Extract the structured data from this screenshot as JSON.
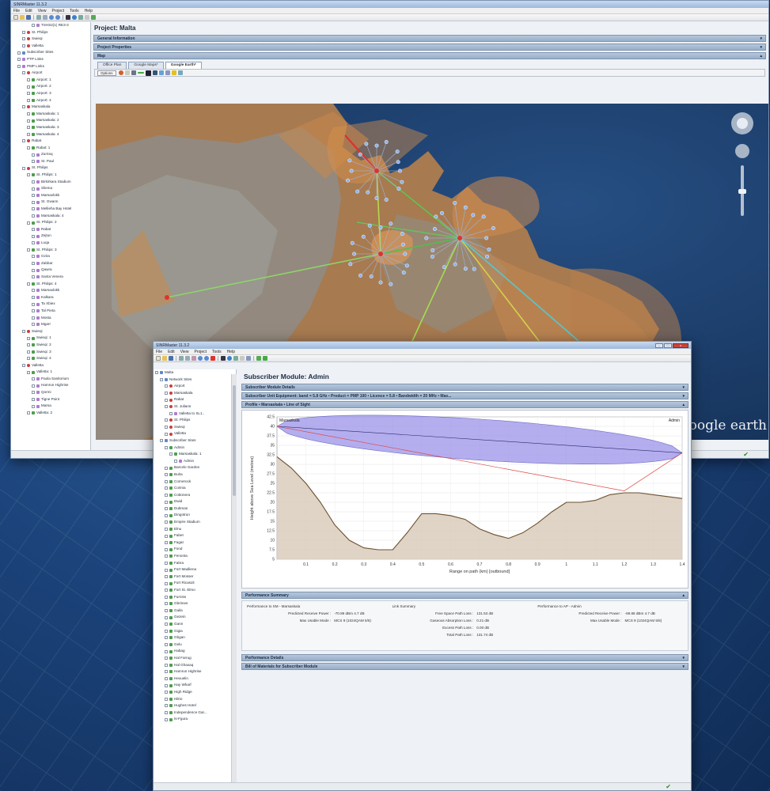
{
  "back_window": {
    "title": "SINRMaster 11.3.2",
    "menu": [
      "File",
      "Edit",
      "View",
      "Project",
      "Tools",
      "Help"
    ],
    "project_title": "Project: Malta",
    "sections": [
      {
        "label": "General Information"
      },
      {
        "label": "Project Properties"
      },
      {
        "label": "Map"
      }
    ],
    "tabs": [
      {
        "label": "Office Plan"
      },
      {
        "label": "Google Maps*"
      },
      {
        "label": "Google Earth*"
      }
    ],
    "map_tool_label": "Options",
    "google_earth_brand": "Google earth",
    "tree": [
      {
        "label": "TSHS2(1) RE3-3",
        "depth": 4,
        "type": "link"
      },
      {
        "label": "St. Philips",
        "depth": 2,
        "type": "site"
      },
      {
        "label": "Swieqi",
        "depth": 2,
        "type": "site"
      },
      {
        "label": "Valletta",
        "depth": 2,
        "type": "site"
      },
      {
        "label": "Subscriber Sites",
        "depth": 1,
        "type": "net"
      },
      {
        "label": "PTP Links",
        "depth": 1,
        "type": "link"
      },
      {
        "label": "PMP Links",
        "depth": 1,
        "type": "link"
      },
      {
        "label": "Airport",
        "depth": 2,
        "type": "site"
      },
      {
        "label": "Airport: 1",
        "depth": 3,
        "type": "sub"
      },
      {
        "label": "Airport: 2",
        "depth": 3,
        "type": "sub"
      },
      {
        "label": "Airport: 3",
        "depth": 3,
        "type": "sub"
      },
      {
        "label": "Airport: 4",
        "depth": 3,
        "type": "sub"
      },
      {
        "label": "Marsaskala",
        "depth": 2,
        "type": "site"
      },
      {
        "label": "Marsaskala: 1",
        "depth": 3,
        "type": "sub"
      },
      {
        "label": "Marsaskala: 2",
        "depth": 3,
        "type": "sub"
      },
      {
        "label": "Marsaskala: 3",
        "depth": 3,
        "type": "sub"
      },
      {
        "label": "Marsaskala: 4",
        "depth": 3,
        "type": "sub"
      },
      {
        "label": "Rabat",
        "depth": 2,
        "type": "site"
      },
      {
        "label": "Rabat: 1",
        "depth": 3,
        "type": "sub"
      },
      {
        "label": "Zurrieq",
        "depth": 4,
        "type": "link"
      },
      {
        "label": "St. Paul",
        "depth": 4,
        "type": "link"
      },
      {
        "label": "St. Philips",
        "depth": 2,
        "type": "site"
      },
      {
        "label": "St. Philips: 1",
        "depth": 3,
        "type": "sub"
      },
      {
        "label": "Birkirkara Stadium",
        "depth": 4,
        "type": "link"
      },
      {
        "label": "Sliema",
        "depth": 4,
        "type": "link"
      },
      {
        "label": "Marsaxlokk",
        "depth": 4,
        "type": "link"
      },
      {
        "label": "St. Gwann",
        "depth": 4,
        "type": "link"
      },
      {
        "label": "Mellieha Bay Hotel",
        "depth": 4,
        "type": "link"
      },
      {
        "label": "Marsaskala: 4",
        "depth": 4,
        "type": "link"
      },
      {
        "label": "St. Philips: 2",
        "depth": 3,
        "type": "sub"
      },
      {
        "label": "Rabat",
        "depth": 4,
        "type": "link"
      },
      {
        "label": "Zejtun",
        "depth": 4,
        "type": "link"
      },
      {
        "label": "Luqa",
        "depth": 4,
        "type": "link"
      },
      {
        "label": "St. Philips: 3",
        "depth": 3,
        "type": "sub"
      },
      {
        "label": "Gzira",
        "depth": 4,
        "type": "link"
      },
      {
        "label": "Zabbar",
        "depth": 4,
        "type": "link"
      },
      {
        "label": "Qawra",
        "depth": 4,
        "type": "link"
      },
      {
        "label": "Santa Venera",
        "depth": 4,
        "type": "link"
      },
      {
        "label": "St. Philips: 4",
        "depth": 3,
        "type": "sub"
      },
      {
        "label": "Marsaxlokk",
        "depth": 4,
        "type": "link"
      },
      {
        "label": "Kalkara",
        "depth": 4,
        "type": "link"
      },
      {
        "label": "Ta Xbiex",
        "depth": 4,
        "type": "link"
      },
      {
        "label": "Tal Pieta",
        "depth": 4,
        "type": "link"
      },
      {
        "label": "Mosta",
        "depth": 4,
        "type": "link"
      },
      {
        "label": "Mgarr",
        "depth": 4,
        "type": "link"
      },
      {
        "label": "Swieqi",
        "depth": 2,
        "type": "site"
      },
      {
        "label": "Swieqi: 1",
        "depth": 3,
        "type": "sub"
      },
      {
        "label": "Swieqi: 2",
        "depth": 3,
        "type": "sub"
      },
      {
        "label": "Swieqi: 3",
        "depth": 3,
        "type": "sub"
      },
      {
        "label": "Swieqi: 4",
        "depth": 3,
        "type": "sub"
      },
      {
        "label": "Valletta",
        "depth": 2,
        "type": "site"
      },
      {
        "label": "Valletta: 1",
        "depth": 3,
        "type": "sub"
      },
      {
        "label": "Paola Sanitorium",
        "depth": 4,
        "type": "link"
      },
      {
        "label": "Hamrun Highrise",
        "depth": 4,
        "type": "link"
      },
      {
        "label": "Qormi",
        "depth": 4,
        "type": "link"
      },
      {
        "label": "Tigne Point",
        "depth": 4,
        "type": "link"
      },
      {
        "label": "Marsa",
        "depth": 4,
        "type": "link"
      },
      {
        "label": "Valletta: 2",
        "depth": 3,
        "type": "sub"
      }
    ]
  },
  "front_window": {
    "title": "SINRMaster 11.3.2",
    "menu": [
      "File",
      "Edit",
      "View",
      "Project",
      "Tools",
      "Help"
    ],
    "page_title": "Subscriber Module: Admin",
    "sections": [
      {
        "label": "Subscriber Module Details"
      },
      {
        "label": "Subscriber Unit Equipment: band = 5.8 GHz • Product = PMP 100 • Licence = 5.8 • Bandwidth = 20 MHz • Max..."
      },
      {
        "label": "Profile • Marsaskala • Line of Sight"
      }
    ],
    "lower_sections": [
      {
        "label": "Performance Summary"
      },
      {
        "label": "Performance Details"
      },
      {
        "label": "Bill of Materials for Subscriber Module"
      }
    ],
    "tree": [
      {
        "label": "Malta",
        "depth": 0,
        "type": "net"
      },
      {
        "label": "Network Sites",
        "depth": 1,
        "type": "net"
      },
      {
        "label": "Airport",
        "depth": 2,
        "type": "site"
      },
      {
        "label": "Marsaskala",
        "depth": 2,
        "type": "site"
      },
      {
        "label": "Rabat",
        "depth": 2,
        "type": "site"
      },
      {
        "label": "St. Julians",
        "depth": 2,
        "type": "site"
      },
      {
        "label": "Valletta to SL1..",
        "depth": 3,
        "type": "link"
      },
      {
        "label": "St. Philips",
        "depth": 2,
        "type": "site"
      },
      {
        "label": "Swieqi",
        "depth": 2,
        "type": "site"
      },
      {
        "label": "Valletta",
        "depth": 2,
        "type": "site"
      },
      {
        "label": "Subscriber Sites",
        "depth": 1,
        "type": "net"
      },
      {
        "label": "Admin",
        "depth": 2,
        "type": "sub"
      },
      {
        "label": "Marsaskala: 1",
        "depth": 3,
        "type": "sub"
      },
      {
        "label": "Admin",
        "depth": 4,
        "type": "link"
      },
      {
        "label": "Barcelo Garden",
        "depth": 2,
        "type": "sub"
      },
      {
        "label": "Bulra",
        "depth": 2,
        "type": "sub"
      },
      {
        "label": "Cornerock",
        "depth": 2,
        "type": "sub"
      },
      {
        "label": "Corinia",
        "depth": 2,
        "type": "sub"
      },
      {
        "label": "Cottonera",
        "depth": 2,
        "type": "sub"
      },
      {
        "label": "Dwid",
        "depth": 2,
        "type": "sub"
      },
      {
        "label": "Dubman",
        "depth": 2,
        "type": "sub"
      },
      {
        "label": "Dingotrun",
        "depth": 2,
        "type": "sub"
      },
      {
        "label": "Empire Stadium",
        "depth": 2,
        "type": "sub"
      },
      {
        "label": "Elnu",
        "depth": 2,
        "type": "sub"
      },
      {
        "label": "Fabet",
        "depth": 2,
        "type": "sub"
      },
      {
        "label": "Fagat",
        "depth": 2,
        "type": "sub"
      },
      {
        "label": "Fond",
        "depth": 2,
        "type": "sub"
      },
      {
        "label": "Fenonta",
        "depth": 2,
        "type": "sub"
      },
      {
        "label": "Fabra",
        "depth": 2,
        "type": "sub"
      },
      {
        "label": "Fort Madliena",
        "depth": 2,
        "type": "sub"
      },
      {
        "label": "Fort Mosser",
        "depth": 2,
        "type": "sub"
      },
      {
        "label": "Fort Ricasoli",
        "depth": 2,
        "type": "sub"
      },
      {
        "label": "Fort St. Elmo",
        "depth": 2,
        "type": "sub"
      },
      {
        "label": "Furniss",
        "depth": 2,
        "type": "sub"
      },
      {
        "label": "Gbrimes",
        "depth": 2,
        "type": "sub"
      },
      {
        "label": "Gaila",
        "depth": 2,
        "type": "sub"
      },
      {
        "label": "Gezein",
        "depth": 2,
        "type": "sub"
      },
      {
        "label": "Gann",
        "depth": 2,
        "type": "sub"
      },
      {
        "label": "Gigia",
        "depth": 2,
        "type": "sub"
      },
      {
        "label": "Gbgan",
        "depth": 2,
        "type": "sub"
      },
      {
        "label": "Gelu",
        "depth": 2,
        "type": "sub"
      },
      {
        "label": "Habag",
        "depth": 2,
        "type": "sub"
      },
      {
        "label": "Hal Farrug",
        "depth": 2,
        "type": "sub"
      },
      {
        "label": "Hal Ghaxaq",
        "depth": 2,
        "type": "sub"
      },
      {
        "label": "Hamrun Highrise",
        "depth": 2,
        "type": "sub"
      },
      {
        "label": "Hexuelin",
        "depth": 2,
        "type": "sub"
      },
      {
        "label": "Hay Wharf",
        "depth": 2,
        "type": "sub"
      },
      {
        "label": "High Ridge",
        "depth": 2,
        "type": "sub"
      },
      {
        "label": "Hilrio",
        "depth": 2,
        "type": "sub"
      },
      {
        "label": "Hughes Hotel",
        "depth": 2,
        "type": "sub"
      },
      {
        "label": "Independence Gar...",
        "depth": 2,
        "type": "sub"
      },
      {
        "label": "Is-Fgura",
        "depth": 2,
        "type": "sub"
      }
    ],
    "perf": {
      "left_title": "Performance to SM - Marsaskala",
      "left_rows": [
        {
          "k": "Predicted Receive Power :",
          "v": "-70.89 dBm  4.7 dB"
        },
        {
          "k": "Max Usable Mode :",
          "v": "MCS 9 (1024QAM 5/6)"
        }
      ],
      "mid_title": "Link Summary",
      "mid_rows": [
        {
          "k": "Free Space Path Loss :",
          "v": "131.53 dB"
        },
        {
          "k": "Gaseous Absorption Loss :",
          "v": "0.21 dB"
        },
        {
          "k": "Excess Path Loss :",
          "v": "0.00 dB"
        },
        {
          "k": "Total Path Loss :",
          "v": "131.74 dB"
        }
      ],
      "right_title": "Performance to AP - Admin",
      "right_rows": [
        {
          "k": "Predicted Receive Power :",
          "v": "-69.88 dBm  4.7 dB"
        },
        {
          "k": "Max Usable Mode :",
          "v": "MCS 9 (1024QAM 5/6)"
        }
      ]
    }
  },
  "colors": {
    "terrain_fill": "#d9cdbb",
    "terrain_line": "#6d5230",
    "fresnel_fill": "#9b93ea",
    "los_line": "#e04848",
    "map_sea": "#1c3e6d",
    "map_land": "#b07a45"
  },
  "chart_data": {
    "type": "area",
    "title": "",
    "xlabel": "Range on path (km) [outbound]",
    "ylabel": "Height above Sea Level (metres)",
    "xlim": [
      0,
      1.4
    ],
    "ylim": [
      5,
      42.5
    ],
    "x_ticks": [
      0.1,
      0.2,
      0.3,
      0.4,
      0.5,
      0.6,
      0.7,
      0.8,
      0.9,
      1,
      1.1,
      1.2,
      1.3,
      1.4
    ],
    "y_ticks": [
      5,
      7.5,
      10,
      12.5,
      15,
      17.5,
      20,
      22.5,
      25,
      27.5,
      30,
      32.5,
      35,
      37.5,
      40,
      42.5
    ],
    "left_end_label": "Marsaskala",
    "right_end_label": "Admin",
    "series": [
      {
        "name": "",
        "x": [
          0,
          0.05,
          0.1,
          0.15,
          0.2,
          0.25,
          0.3,
          0.35,
          0.4,
          0.45,
          0.5,
          0.55,
          0.6,
          0.65,
          0.7,
          0.75,
          0.8,
          0.85,
          0.9,
          0.95,
          1.0,
          1.05,
          1.1,
          1.15,
          1.2,
          1.25,
          1.3,
          1.35,
          1.4
        ],
        "values": [
          32,
          29,
          25,
          20,
          14,
          10,
          8,
          7.5,
          7.5,
          12,
          17,
          17,
          16.5,
          15.5,
          13,
          11.5,
          10.5,
          12,
          14.5,
          17.5,
          20,
          20,
          20.5,
          22,
          22.5,
          22.5,
          22,
          21.5,
          21
        ]
      }
    ],
    "los_start": [
      0,
      40
    ],
    "los_end": [
      1.4,
      33
    ],
    "fresnel_max_half_height": 5.4
  }
}
